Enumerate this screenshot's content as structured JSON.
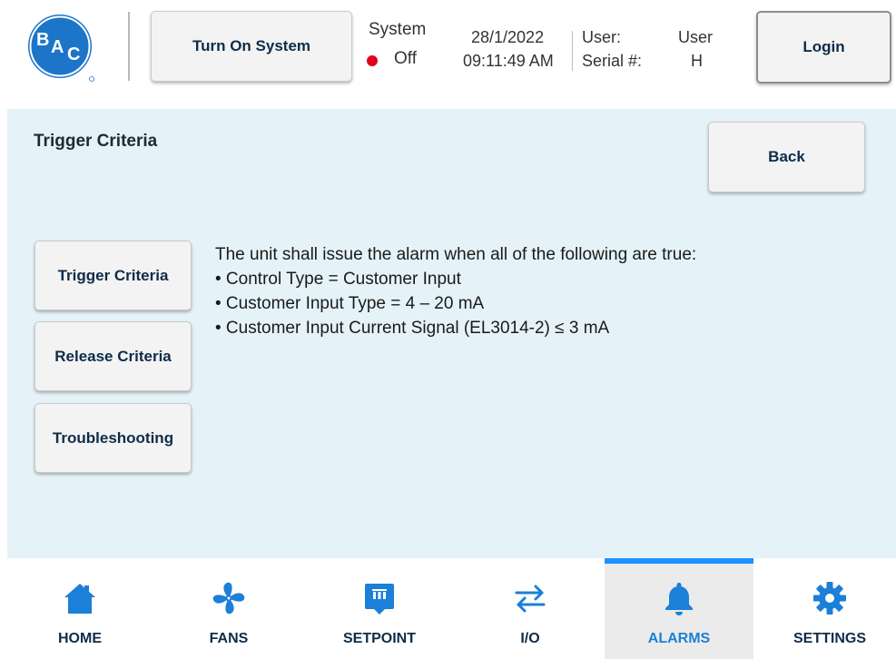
{
  "header": {
    "logo_text": "BAC",
    "turn_on_button": "Turn On System",
    "system_label": "System",
    "system_state": "Off",
    "status_color": "#e4001b",
    "date": "28/1/2022",
    "time": "09:11:49 AM",
    "user_label": "User:",
    "user_value": "User",
    "serial_label": "Serial #:",
    "serial_value": "H",
    "login_button": "Login"
  },
  "main": {
    "title": "Trigger Criteria",
    "back_button": "Back",
    "side_buttons": [
      "Trigger Criteria",
      "Release Criteria",
      "Troubleshooting"
    ],
    "content": {
      "intro": "The unit shall issue the alarm when all of the following are true:",
      "bullets": [
        "• Control Type = Customer Input",
        "• Customer Input Type = 4 – 20 mA",
        "• Customer Input Current Signal (EL3014-2) ≤ 3 mA"
      ]
    }
  },
  "nav": {
    "active": "ALARMS",
    "accent_color": "#1e90ff",
    "icon_color": "#1c7fd8",
    "items": [
      {
        "label": "HOME",
        "icon": "home-icon"
      },
      {
        "label": "FANS",
        "icon": "fan-icon"
      },
      {
        "label": "SETPOINT",
        "icon": "setpoint-icon"
      },
      {
        "label": "I/O",
        "icon": "io-arrows-icon"
      },
      {
        "label": "ALARMS",
        "icon": "bell-icon"
      },
      {
        "label": "SETTINGS",
        "icon": "gear-icon"
      }
    ]
  }
}
